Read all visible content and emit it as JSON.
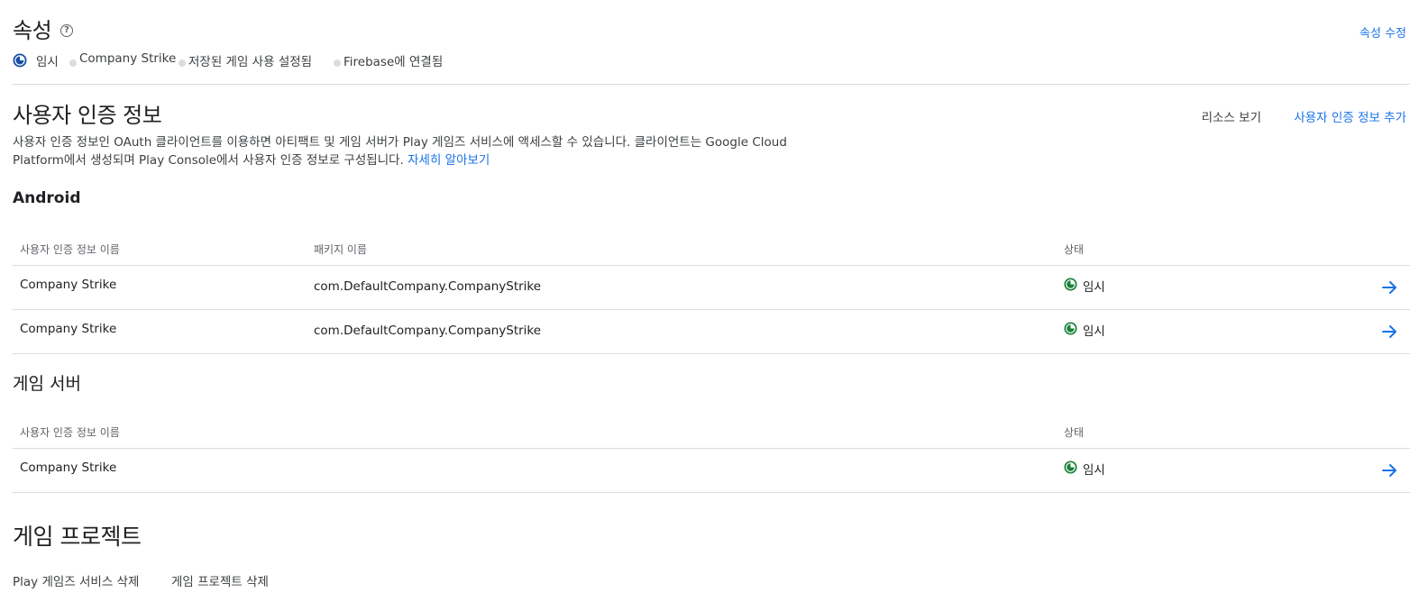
{
  "properties": {
    "title": "속성",
    "edit_label": "속성 수정",
    "statuses": [
      {
        "label": "임시",
        "icon": "pending-icon"
      },
      {
        "label": "Company Strike",
        "icon": "dot-icon"
      },
      {
        "label": "저장된 게임 사용 설정됨",
        "icon": "dot-icon"
      },
      {
        "label": "Firebase에 연결됨",
        "icon": "dot-icon"
      }
    ]
  },
  "credentials": {
    "title": "사용자 인증 정보",
    "view_resources_label": "리소스 보기",
    "add_credential_label": "사용자 인증 정보 추가",
    "description": "사용자 인증 정보인 OAuth 클라이언트를 이용하면 아티팩트 및 게임 서버가 Play 게임즈 서비스에 액세스할 수 있습니다. 클라이언트는 Google Cloud Platform에서 생성되며 Play Console에서 사용자 인증 정보로 구성됩니다.",
    "learn_more_label": "자세히 알아보기"
  },
  "android": {
    "title": "Android",
    "columns": [
      "사용자 인증 정보 이름",
      "패키지 이름",
      "상태"
    ],
    "rows": [
      {
        "name": "Company Strike",
        "package": "com.DefaultCompany.CompanyStrike",
        "status": "임시"
      },
      {
        "name": "Company Strike",
        "package": "com.DefaultCompany.CompanyStrike",
        "status": "임시"
      }
    ]
  },
  "game_server": {
    "title": "게임 서버",
    "columns": [
      "사용자 인증 정보 이름",
      "상태"
    ],
    "rows": [
      {
        "name": "Company Strike",
        "status": "임시"
      }
    ]
  },
  "game_project": {
    "title": "게임 프로젝트",
    "delete_pgs_label": "Play 게임즈 서비스 삭제",
    "delete_project_label": "게임 프로젝트 삭제"
  },
  "colors": {
    "link": "#1a73e8",
    "pending_green": "#188038",
    "pending_navy": "#174ea6",
    "divider": "#dadce0"
  }
}
